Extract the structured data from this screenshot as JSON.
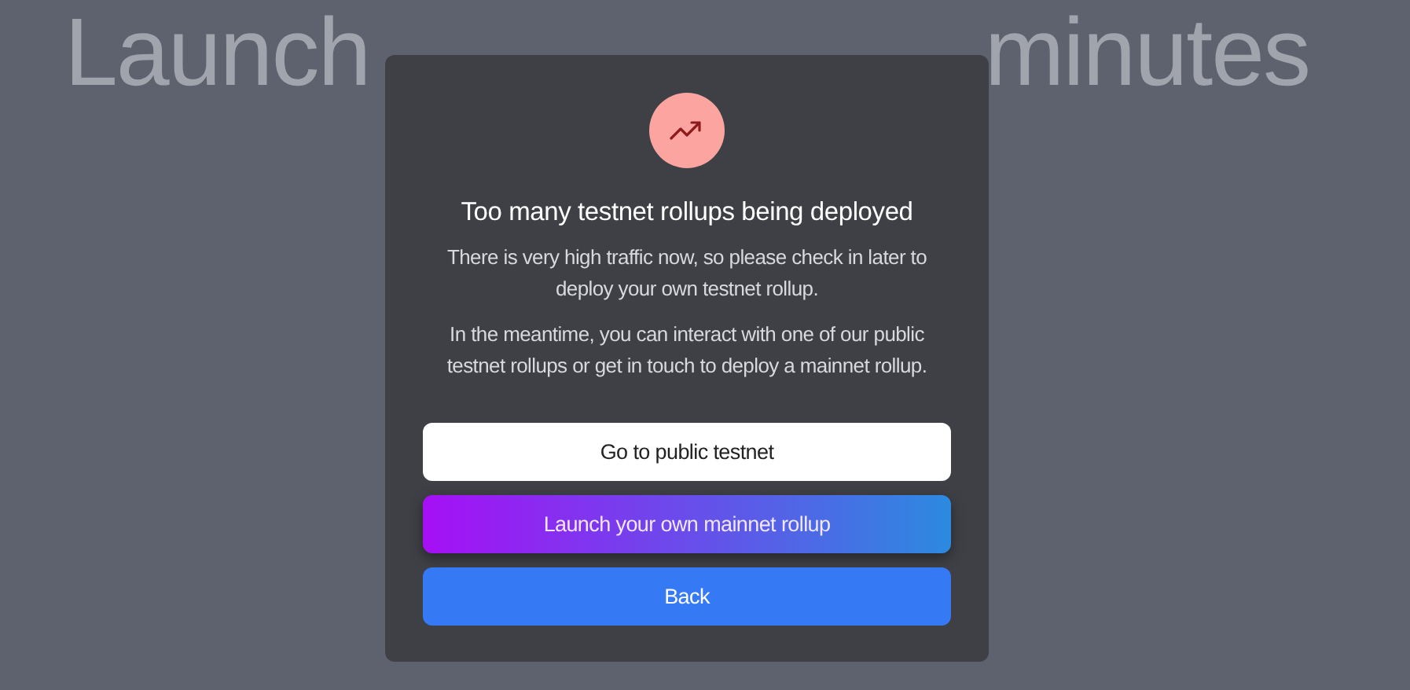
{
  "page": {
    "heading": [
      "Launch",
      "minutes"
    ]
  },
  "modal": {
    "title": "Too many testnet rollups being deployed",
    "paragraphs": [
      "There is very high traffic now, so please check in later to deploy your own testnet rollup.",
      "In the meantime, you can interact with one of our public testnet rollups or get in touch to deploy a mainnet rollup."
    ],
    "buttons": [
      {
        "label": "Go to public testnet",
        "kind": "secondary"
      },
      {
        "label": "Launch your own mainnet rollup",
        "kind": "gradient"
      },
      {
        "label": "Back",
        "kind": "primary"
      }
    ]
  }
}
